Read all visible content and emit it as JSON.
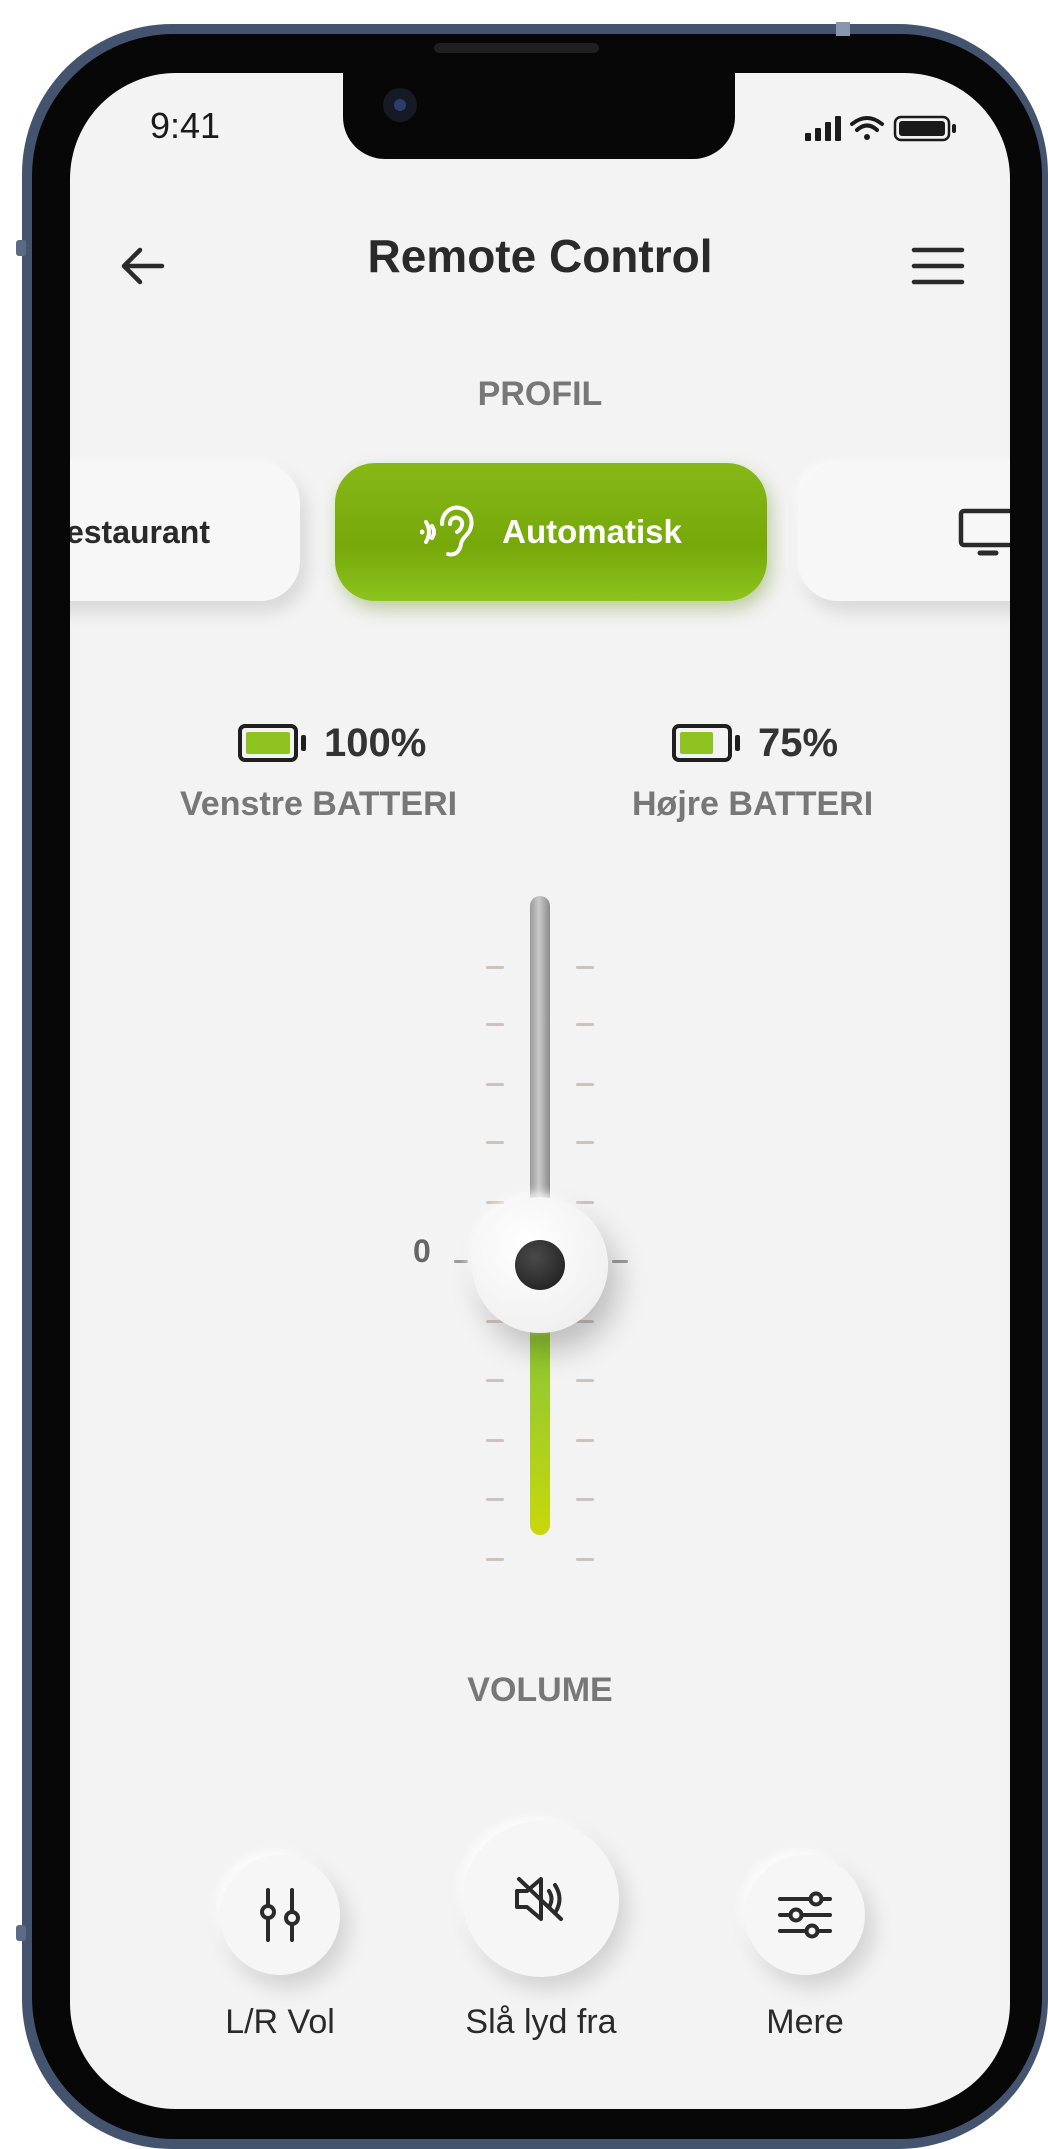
{
  "status_bar": {
    "time": "9:41"
  },
  "header": {
    "title": "Remote Control"
  },
  "profile": {
    "section_label": "PROFIL",
    "chips": [
      {
        "label": "Restaurant",
        "icon": "restaurant-profile"
      },
      {
        "label": "Automatisk",
        "icon": "ear-sound-icon",
        "active": true
      },
      {
        "label": "",
        "icon": "tv-icon"
      }
    ],
    "accent_color": "#7fb010"
  },
  "batteries": {
    "left": {
      "percent": "100%",
      "label": "Venstre BATTERI",
      "level": 1.0
    },
    "right": {
      "percent": "75%",
      "label": "Højre BATTERI",
      "level": 0.75
    }
  },
  "volume": {
    "label": "VOLUME",
    "zero_label": "0",
    "value": 0
  },
  "actions": [
    {
      "label": "L/R Vol",
      "icon": "sliders-vertical-icon"
    },
    {
      "label": "Slå lyd fra",
      "icon": "mute-speaker-icon"
    },
    {
      "label": "Mere",
      "icon": "sliders-horizontal-icon"
    }
  ]
}
